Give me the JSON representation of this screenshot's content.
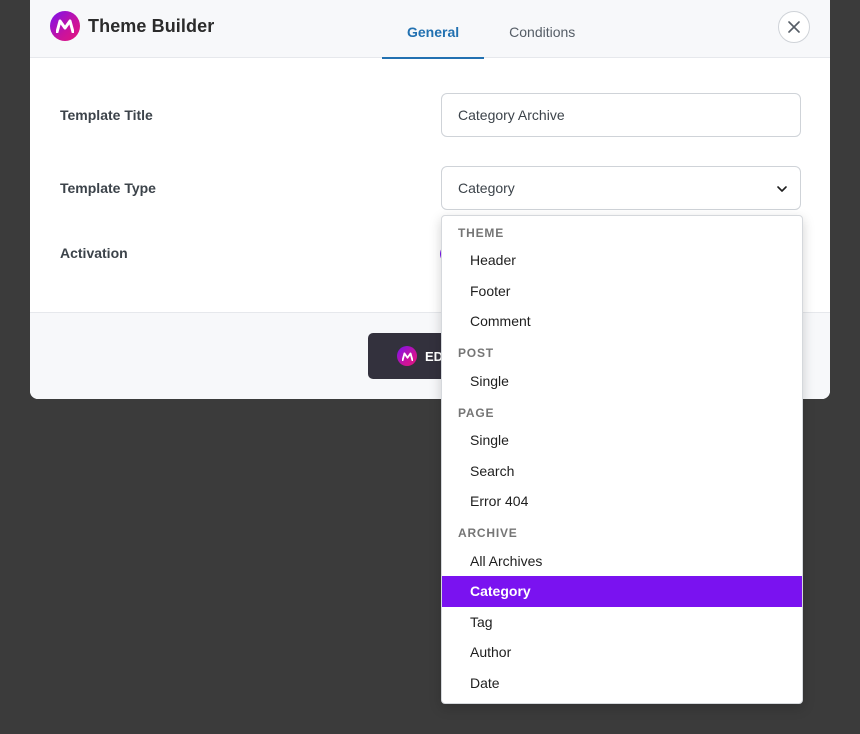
{
  "header": {
    "title": "Theme Builder",
    "tabs": [
      {
        "label": "General",
        "active": true
      },
      {
        "label": "Conditions",
        "active": false
      }
    ]
  },
  "form": {
    "template_title": {
      "label": "Template Title",
      "value": "Category Archive"
    },
    "template_type": {
      "label": "Template Type",
      "value": "Category"
    },
    "activation": {
      "label": "Activation"
    }
  },
  "footer": {
    "edit_button_label": "ED"
  },
  "dropdown": {
    "groups": [
      {
        "label": "THEME",
        "items": [
          "Header",
          "Footer",
          "Comment"
        ]
      },
      {
        "label": "POST",
        "items": [
          "Single"
        ]
      },
      {
        "label": "PAGE",
        "items": [
          "Single",
          "Search",
          "Error 404"
        ]
      },
      {
        "label": "ARCHIVE",
        "items": [
          "All Archives",
          "Category",
          "Tag",
          "Author",
          "Date"
        ]
      }
    ],
    "selected": "Category"
  },
  "colors": {
    "accent": "#7a12f0",
    "tab_active": "#2271b1",
    "overlay": "#3b3b3b"
  },
  "icons": {
    "logo": "brand-m-logo-icon",
    "close": "close-icon",
    "chevron": "chevron-down-icon"
  }
}
